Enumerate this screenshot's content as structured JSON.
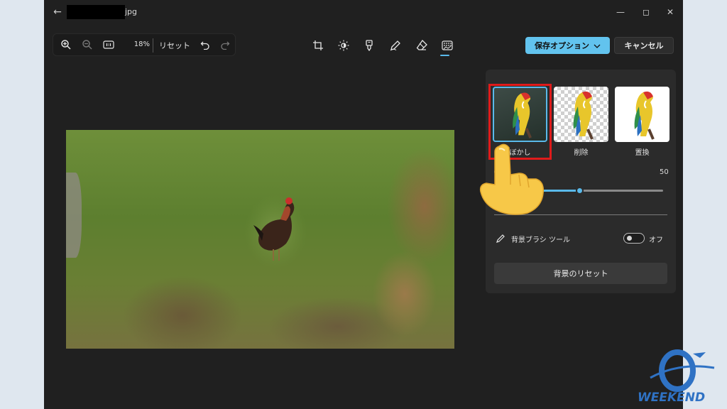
{
  "titlebar": {
    "filename_ext": "jpg"
  },
  "toolbar": {
    "zoom_percent": "18%",
    "reset_label": "リセット",
    "save_label": "保存オプション",
    "cancel_label": "キャンセル"
  },
  "panel": {
    "options": [
      {
        "label": "ぼかし",
        "selected": true
      },
      {
        "label": "削除",
        "selected": false
      },
      {
        "label": "置換",
        "selected": false
      }
    ],
    "blur_strength": 50,
    "blur_strength_label": "50",
    "brush_tool_label": "背景ブラシ ツール",
    "brush_toggle_label": "オフ",
    "brush_toggle_on": false,
    "reset_background_label": "背景のリセット"
  },
  "watermark": {
    "text": "WEEKEND"
  },
  "colors": {
    "accent": "#5ab9ea",
    "save_button": "#62c3ee",
    "highlight": "#e01b1b"
  }
}
